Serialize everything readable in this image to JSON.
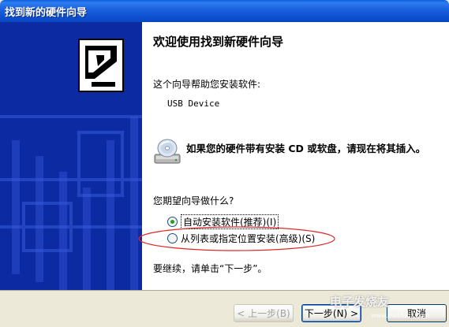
{
  "window": {
    "title": "找到新的硬件向导"
  },
  "content": {
    "heading": "欢迎使用找到新硬件向导",
    "intro": "这个向导帮助您安装软件:",
    "device_name": "USB Device",
    "cd_prompt": "如果您的硬件带有安装 CD 或软盘，请现在将其插入。",
    "question": "您期望向导做什么?",
    "options": [
      {
        "label": "自动安装软件(推荐)(I)",
        "selected": true
      },
      {
        "label": "从列表或指定位置安装(高级)(S)",
        "selected": false
      }
    ],
    "continue_hint": "要继续，请单击“下一步”。"
  },
  "buttons": {
    "back": "< 上一步(B)",
    "next": "下一步(N) >",
    "cancel": "取消"
  },
  "watermark": {
    "brand": "电子发烧友",
    "url": "www.elecfans.com"
  },
  "icons": {
    "banner": "hardware-wizard-icon",
    "cd": "cd-disk-icon"
  },
  "colors": {
    "title_bar": "#0b4fd0",
    "side_banner": "#0c2aa2",
    "radio_dot": "#21a121",
    "annotation": "#e0282a"
  }
}
